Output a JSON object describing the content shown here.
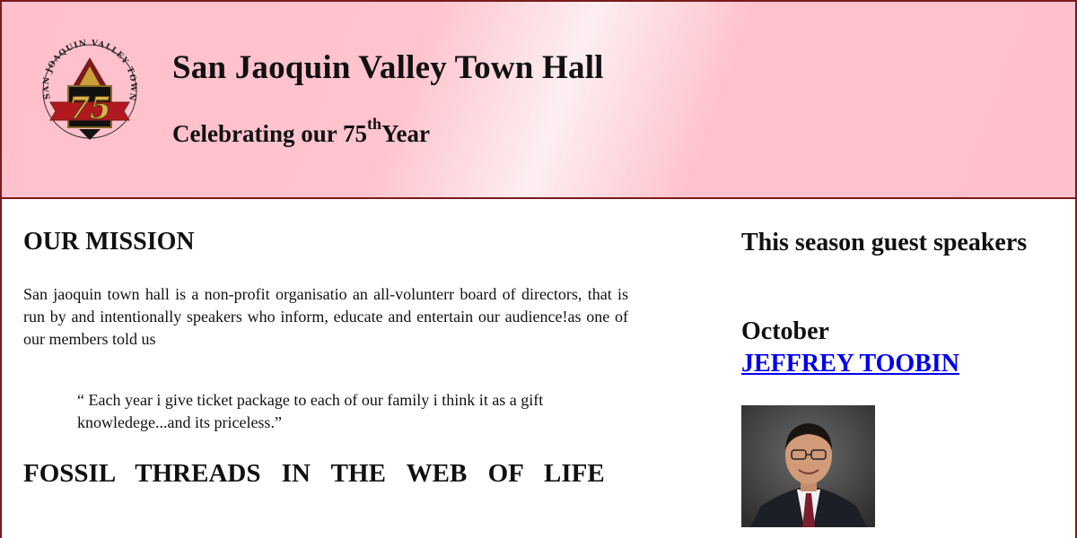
{
  "header": {
    "title": "San Jaoquin Valley Town Hall",
    "tagline_prefix": "Celebrating our 75",
    "tagline_sup": "th",
    "tagline_suffix": "Year",
    "logo": {
      "ring_text": "SAN JOAQUIN VALLEY TOWN HALL",
      "number": "75"
    }
  },
  "main": {
    "mission_heading": "OUR MISSION",
    "mission_text": "San jaoquin town hall is a non-profit organisatio an all-volunterr board of directors, that is run by and intentionally speakers who inform, educate and entertain our audience!as one of our members told us",
    "quote": "“ Each year i give ticket package to each of our family i think it as a gift knowledege...and its priceless.”",
    "fossil_heading": "FOSSIL THREADS IN THE WEB OF LIFE"
  },
  "aside": {
    "season_heading": "This season guest speakers",
    "month": "October",
    "speaker_name": "JEFFREY TOOBIN",
    "speaker_photo_icon": "speaker-portrait"
  },
  "colors": {
    "header_pink": "#ffc0cb",
    "border": "#7a1a1a",
    "link": "#0000ee"
  }
}
